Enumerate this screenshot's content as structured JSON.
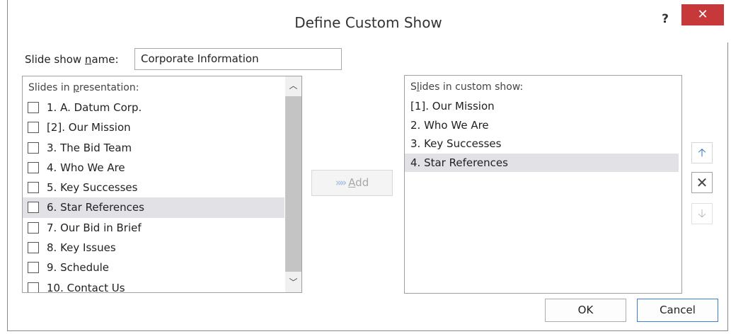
{
  "dialog": {
    "title": "Define Custom Show",
    "help_label": "?",
    "close_label": "✕"
  },
  "name_field": {
    "label_prefix": "Slide show ",
    "label_underlined": "n",
    "label_suffix": "ame:",
    "value": "Corporate Information"
  },
  "left_list": {
    "header_prefix": "Slides in ",
    "header_underlined": "p",
    "header_suffix": "resentation:",
    "items": [
      {
        "label": "1. A. Datum Corp.",
        "checked": false
      },
      {
        "label": "[2]. Our Mission",
        "checked": false
      },
      {
        "label": "3. The Bid Team",
        "checked": false
      },
      {
        "label": "4. Who We Are",
        "checked": false
      },
      {
        "label": "5. Key Successes",
        "checked": false
      },
      {
        "label": "6. Star References",
        "checked": false,
        "selected": true
      },
      {
        "label": "7. Our Bid in Brief",
        "checked": false
      },
      {
        "label": "8. Key Issues",
        "checked": false
      },
      {
        "label": "9. Schedule",
        "checked": false
      },
      {
        "label": "10. Contact Us",
        "checked": false
      }
    ]
  },
  "add_button": {
    "arrows": "»»",
    "label_underlined": "A",
    "label_suffix": "dd"
  },
  "right_list": {
    "header_prefix": "S",
    "header_underlined": "l",
    "header_suffix": "ides in custom show:",
    "items": [
      {
        "label": "[1]. Our Mission"
      },
      {
        "label": "2. Who We Are"
      },
      {
        "label": "3. Key Successes"
      },
      {
        "label": "4. Star References",
        "selected": true
      }
    ]
  },
  "side_buttons": {
    "up": "🡡",
    "remove": "✕",
    "down": "🡣"
  },
  "footer": {
    "ok_label": "OK",
    "cancel_label": "Cancel"
  },
  "colors": {
    "close_bg": "#c7383b",
    "selection_bg": "#e1e1e6",
    "accent_blue": "#2e6fc7"
  }
}
